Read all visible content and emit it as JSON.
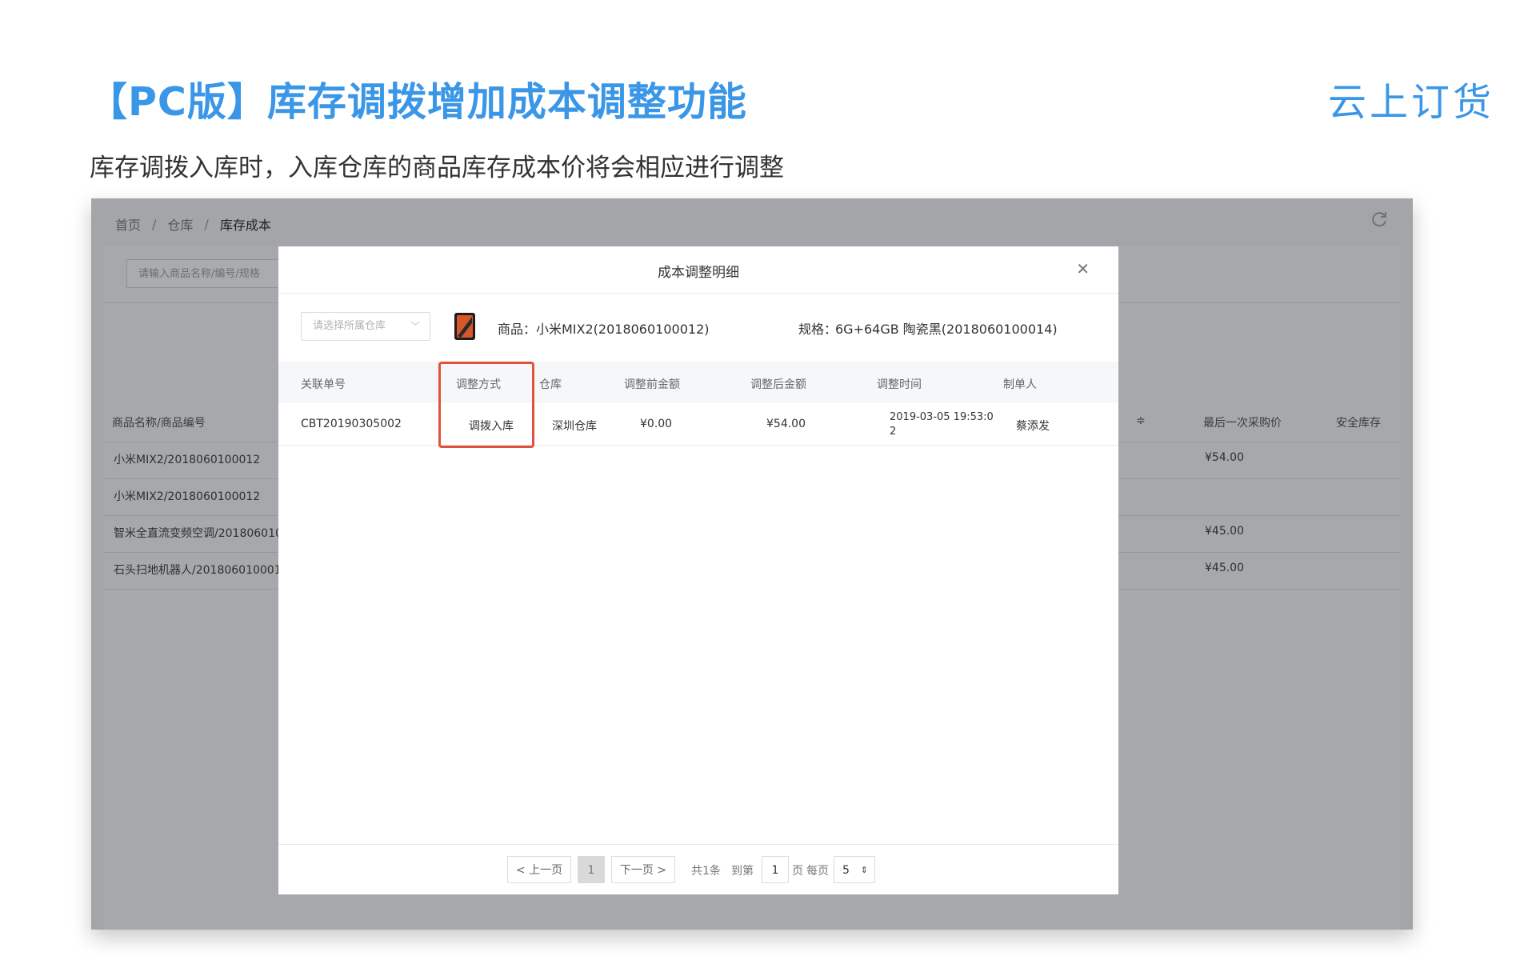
{
  "slide": {
    "title": "【PC版】库存调拨增加成本调整功能",
    "subtitle": "库存调拨入库时，入库仓库的商品库存成本价将会相应进行调整",
    "logo": "云上订货"
  },
  "breadcrumb": {
    "items": [
      "首页",
      "仓库",
      "库存成本"
    ],
    "separator": "/"
  },
  "background": {
    "search_placeholder": "请输入商品名称/编号/规格",
    "headers": {
      "name": "商品名称/商品编号",
      "partial": "≑",
      "last_price": "最后一次采购价",
      "safety_stock": "安全库存"
    },
    "rows": [
      {
        "name": "小米MIX2/2018060100012",
        "last_price": "¥54.00"
      },
      {
        "name": "小米MIX2/2018060100012",
        "last_price": ""
      },
      {
        "name": "智米全直流变频空调/201806010",
        "last_price": "¥45.00"
      },
      {
        "name": "石头扫地机器人/201806010001",
        "last_price": "¥45.00"
      }
    ]
  },
  "modal": {
    "title": "成本调整明细",
    "close_icon": "close-icon",
    "warehouse_placeholder": "请选择所属仓库",
    "product_label": "商品：",
    "product_value": "小米MIX2(2018060100012)",
    "spec_label": "规格：",
    "spec_value": "6G+64GB 陶瓷黑(2018060100014)",
    "columns": [
      "关联单号",
      "调整方式",
      "仓库",
      "调整前金额",
      "调整后金额",
      "调整时间",
      "制单人"
    ],
    "rows": [
      {
        "order_no": "CBT20190305002",
        "method": "调拨入库",
        "warehouse": "深圳仓库",
        "before": "¥0.00",
        "after": "¥54.00",
        "time_line1": "2019-03-05 19:53:0",
        "time_line2": "2",
        "creator": "蔡添发"
      }
    ],
    "pagination": {
      "prev": "< 上一页",
      "current_page": "1",
      "next": "下一页 >",
      "total": "共1条",
      "goto_label": "到第",
      "goto_value": "1",
      "page_label": "页",
      "per_page_label": "每页",
      "per_page_value": "5"
    }
  },
  "colors": {
    "accent": "#3a96e6",
    "highlight": "#e0533a",
    "overlay": "#a3a5a8"
  }
}
